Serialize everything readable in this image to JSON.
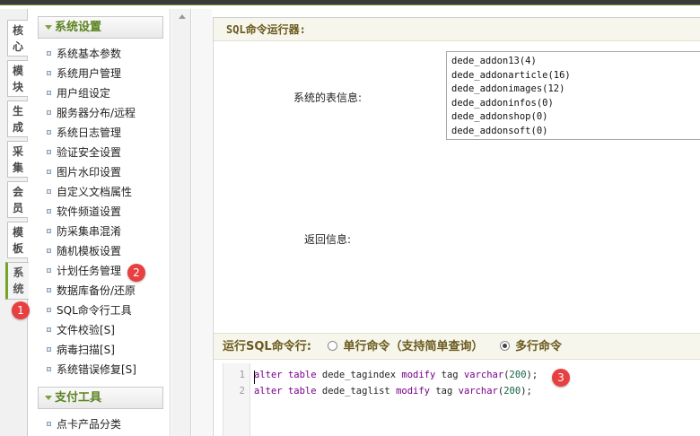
{
  "side_tabs": [
    "核心",
    "模块",
    "生成",
    "采集",
    "会员",
    "模板",
    "系统"
  ],
  "menu": {
    "group1": "系统设置",
    "items": [
      "系统基本参数",
      "系统用户管理",
      "用户组设定",
      "服务器分布/远程",
      "系统日志管理",
      "验证安全设置",
      "图片水印设置",
      "自定义文档属性",
      "软件频道设置",
      "防采集串混淆",
      "随机模板设置",
      "计划任务管理",
      "数据库备份/还原",
      "SQL命令行工具",
      "文件校验[S]",
      "病毒扫描[S]",
      "系统错误修复[S]"
    ],
    "group2": "支付工具",
    "items2": [
      "点卡产品分类"
    ]
  },
  "main": {
    "title": "SQL命令运行器:",
    "table_info_label": "系统的表信息:",
    "tables": [
      "dede_addon13(4)",
      "dede_addonarticle(16)",
      "dede_addonimages(12)",
      "dede_addoninfos(0)",
      "dede_addonshop(0)",
      "dede_addonsoft(0)"
    ],
    "return_label": "返回信息:",
    "run_label": "运行SQL命令行:",
    "opt_single": "单行命令（支持简单查询）",
    "opt_multi": "多行命令",
    "line_nums": [
      "1",
      "2"
    ],
    "code": {
      "line1": {
        "kw1": "alter",
        "kw2": "table",
        "tbl": "dede_tagindex",
        "kw3": "modify",
        "col": "tag",
        "type": "varchar",
        "num": "200"
      },
      "line2": {
        "kw1": "alter",
        "kw2": "table",
        "tbl": "dede_taglist",
        "kw3": "modify",
        "col": "tag",
        "type": "varchar",
        "num": "200"
      }
    }
  },
  "badges": [
    "1",
    "2",
    "3"
  ]
}
